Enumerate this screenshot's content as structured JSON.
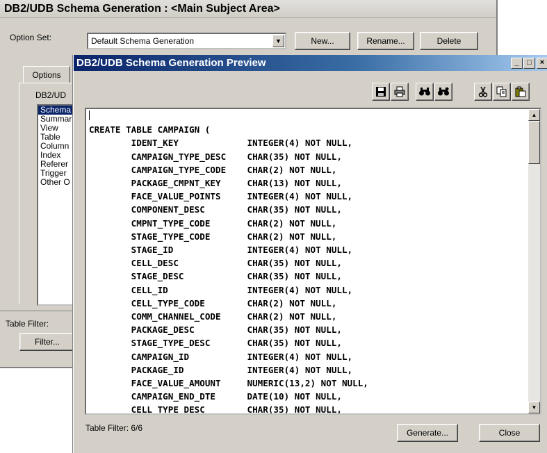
{
  "back_window": {
    "title": "DB2/UDB Schema Generation : <Main Subject Area>",
    "option_set_label": "Option Set:",
    "option_set_value": "Default Schema Generation",
    "new_button": "New...",
    "rename_button": "Rename...",
    "delete_button": "Delete",
    "tab_options": "Options",
    "group_label": "DB2/UD",
    "list_items": [
      "Schema",
      "Summar",
      "View",
      "Table",
      "Column",
      "Index",
      "Referer",
      "Trigger",
      "Other O"
    ],
    "table_filter_label": "Table Filter:",
    "filter_button": "Filter..."
  },
  "preview_window": {
    "title": "DB2/UDB Schema Generation Preview",
    "minimize": "_",
    "maximize": "□",
    "close_glyph": "×",
    "toolbar_icons": [
      "save-icon",
      "print-icon",
      "find-icon",
      "find-next-icon",
      "cut-icon",
      "copy-icon",
      "paste-icon"
    ],
    "sql_header": "CREATE TABLE CAMPAIGN (",
    "columns": [
      {
        "name": "IDENT_KEY",
        "type": "INTEGER(4) NOT NULL,"
      },
      {
        "name": "CAMPAIGN_TYPE_DESC",
        "type": "CHAR(35) NOT NULL,"
      },
      {
        "name": "CAMPAIGN_TYPE_CODE",
        "type": "CHAR(2) NOT NULL,"
      },
      {
        "name": "PACKAGE_CMPNT_KEY",
        "type": "CHAR(13) NOT NULL,"
      },
      {
        "name": "FACE_VALUE_POINTS",
        "type": "INTEGER(4) NOT NULL,"
      },
      {
        "name": "COMPONENT_DESC",
        "type": "CHAR(35) NOT NULL,"
      },
      {
        "name": "CMPNT_TYPE_CODE",
        "type": "CHAR(2) NOT NULL,"
      },
      {
        "name": "STAGE_TYPE_CODE",
        "type": "CHAR(2) NOT NULL,"
      },
      {
        "name": "STAGE_ID",
        "type": "INTEGER(4) NOT NULL,"
      },
      {
        "name": "CELL_DESC",
        "type": "CHAR(35) NOT NULL,"
      },
      {
        "name": "STAGE_DESC",
        "type": "CHAR(35) NOT NULL,"
      },
      {
        "name": "CELL_ID",
        "type": "INTEGER(4) NOT NULL,"
      },
      {
        "name": "CELL_TYPE_CODE",
        "type": "CHAR(2) NOT NULL,"
      },
      {
        "name": "COMM_CHANNEL_CODE",
        "type": "CHAR(2) NOT NULL,"
      },
      {
        "name": "PACKAGE_DESC",
        "type": "CHAR(35) NOT NULL,"
      },
      {
        "name": "STAGE_TYPE_DESC",
        "type": "CHAR(35) NOT NULL,"
      },
      {
        "name": "CAMPAIGN_ID",
        "type": "INTEGER(4) NOT NULL,"
      },
      {
        "name": "PACKAGE_ID",
        "type": "INTEGER(4) NOT NULL,"
      },
      {
        "name": "FACE_VALUE_AMOUNT",
        "type": "NUMERIC(13,2) NOT NULL,"
      },
      {
        "name": "CAMPAIGN_END_DTE",
        "type": "DATE(10) NOT NULL,"
      },
      {
        "name": "CELL_TYPE_DESC",
        "type": "CHAR(35) NOT NULL,"
      }
    ],
    "table_filter_status": "Table Filter: 6/6",
    "generate_button": "Generate...",
    "close_button": "Close"
  },
  "colors": {
    "dialog_face": "#d4d0c8",
    "title_active_start": "#0a246a",
    "title_active_end": "#a6caf0",
    "selection": "#0a246a"
  }
}
